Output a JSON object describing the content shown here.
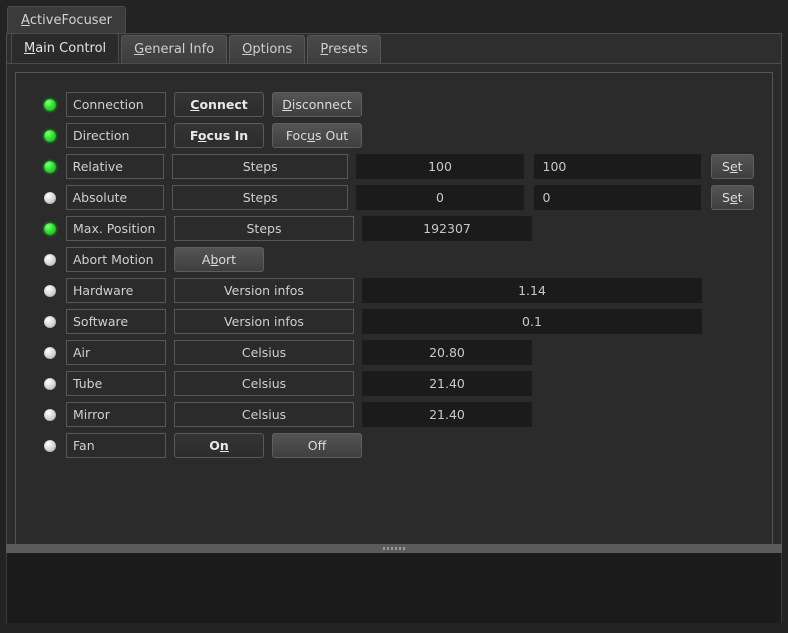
{
  "window": {
    "tab_label_prefix": "A",
    "tab_label_rest": "ctiveFocuser"
  },
  "tabs": [
    {
      "mnem": "M",
      "rest": "ain Control",
      "active": true
    },
    {
      "mnem": "G",
      "rest": "eneral Info",
      "active": false
    },
    {
      "mnem": "O",
      "rest": "ptions",
      "active": false
    },
    {
      "mnem": "P",
      "rest": "resets",
      "active": false
    }
  ],
  "colors": {
    "led_on": "#2ee22e",
    "led_off": "#dcdcdc",
    "panel_bg": "#2b2b2b",
    "value_bg": "#1b1b1b",
    "text": "#d0d0d0"
  },
  "rows": [
    {
      "led": "on",
      "label": "Connection",
      "buttons": [
        {
          "mnem": "C",
          "rest": "onnect",
          "pressed": true,
          "name": "connect-button"
        },
        {
          "mnem": "D",
          "rest": "isconnect",
          "pressed": false,
          "name": "disconnect-button"
        }
      ]
    },
    {
      "led": "on",
      "label": "Direction",
      "buttons": [
        {
          "pre": "F",
          "mnem": "o",
          "rest": "cus In",
          "pressed": true,
          "name": "focus-in-button"
        },
        {
          "pre": "Foc",
          "mnem": "u",
          "rest": "s Out",
          "pressed": false,
          "name": "focus-out-button"
        }
      ]
    },
    {
      "led": "on",
      "label": "Relative",
      "unit": "Steps",
      "value": "100",
      "input": "100",
      "set": {
        "pre": "S",
        "mnem": "e",
        "rest": "t"
      }
    },
    {
      "led": "off",
      "label": "Absolute",
      "unit": "Steps",
      "value": "0",
      "input": "0",
      "set": {
        "pre": "S",
        "mnem": "e",
        "rest": "t"
      }
    },
    {
      "led": "on",
      "label": "Max. Position",
      "unit": "Steps",
      "value": "192307"
    },
    {
      "led": "off",
      "label": "Abort Motion",
      "buttons": [
        {
          "pre": "A",
          "mnem": "b",
          "rest": "ort",
          "pressed": false,
          "name": "abort-button"
        }
      ]
    },
    {
      "led": "off",
      "label": "Hardware",
      "unit": "Version infos",
      "value_wide": "1.14"
    },
    {
      "led": "off",
      "label": "Software",
      "unit": "Version infos",
      "value_wide": "0.1"
    },
    {
      "led": "off",
      "label": "Air",
      "unit": "Celsius",
      "value": "20.80"
    },
    {
      "led": "off",
      "label": "Tube",
      "unit": "Celsius",
      "value": "21.40"
    },
    {
      "led": "off",
      "label": "Mirror",
      "unit": "Celsius",
      "value": "21.40"
    },
    {
      "led": "off",
      "label": "Fan",
      "buttons": [
        {
          "pre": "O",
          "mnem": "n",
          "rest": "",
          "pressed": true,
          "name": "fan-on-button"
        },
        {
          "pre": "Off",
          "mnem": "",
          "rest": "",
          "pressed": false,
          "name": "fan-off-button"
        }
      ]
    }
  ]
}
